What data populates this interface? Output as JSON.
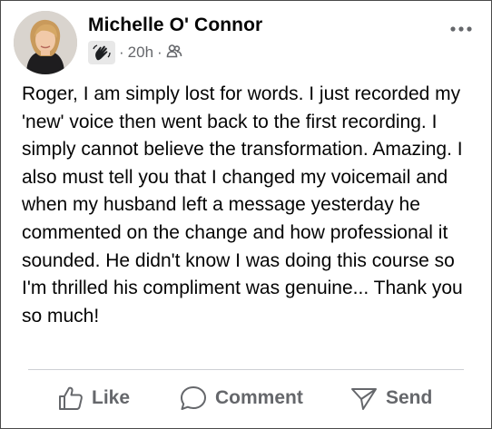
{
  "post": {
    "author": "Michelle O' Connor",
    "time": "20h",
    "separator": "·",
    "body": "Roger, I am simply lost for words. I just recorded my 'new' voice then went back to the first recording. I simply cannot believe the transformation. Amazing. I also must tell you that I changed my voicemail and when my husband left a message yesterday he commented on the change and how professional it sounded. He didn't know I was doing this course so I'm thrilled his compliment was genuine... Thank you so much!"
  },
  "actions": {
    "like": "Like",
    "comment": "Comment",
    "send": "Send"
  },
  "icons": {
    "group": "hand-badge-icon",
    "audience": "friends-audience-icon",
    "more": "more-options-icon",
    "like": "thumbs-up-icon",
    "comment": "comment-bubble-icon",
    "send": "send-icon"
  },
  "colors": {
    "text": "#050505",
    "secondary": "#65676b",
    "divider": "#ced0d4"
  }
}
